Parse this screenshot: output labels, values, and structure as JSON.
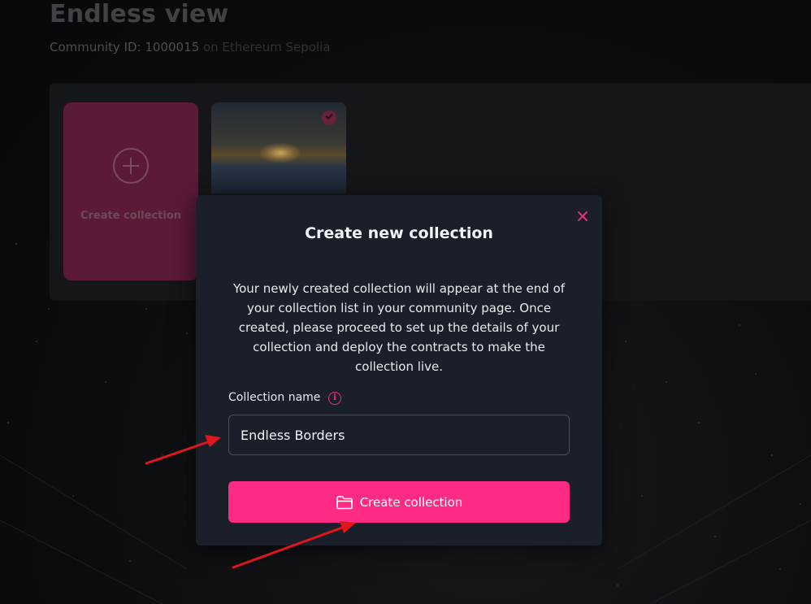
{
  "page": {
    "title": "Endless view",
    "community_label": "Community ID: 1000015",
    "network_label": "on Ethereum Sepolia"
  },
  "cards": {
    "create_label": "Create collection"
  },
  "modal": {
    "title": "Create new collection",
    "description": "Your newly created collection will appear at the end of your collection list in your community page. Once created, please proceed to set up the details of your collection and deploy the contracts to make the collection live.",
    "field_label": "Collection name",
    "info_glyph": "i",
    "input_value": "Endless Borders",
    "submit_label": "Create collection"
  },
  "icons": {
    "close": "close-icon",
    "info": "info-icon",
    "folder": "folder-icon",
    "add": "plus-circle-icon",
    "selected": "check-icon"
  },
  "colors": {
    "accent": "#fe2b84",
    "modal_bg": "#1b1f29",
    "annotation_arrow": "#e0161c"
  }
}
